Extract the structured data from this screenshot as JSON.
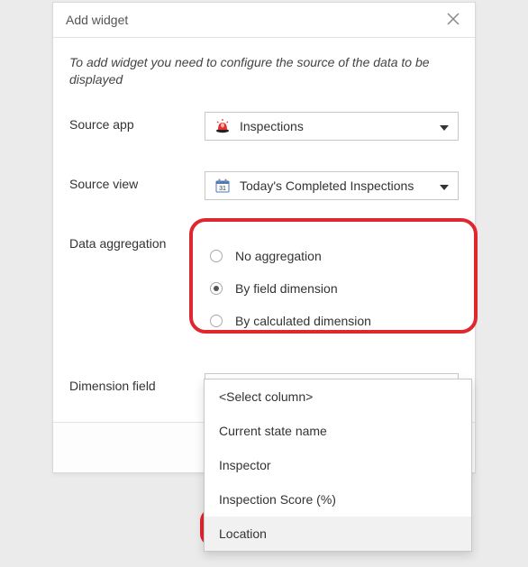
{
  "dialog": {
    "title": "Add widget",
    "intro": "To add widget you need to configure the source of the data to be displayed"
  },
  "fields": {
    "source_app": {
      "label": "Source app",
      "value": "Inspections"
    },
    "source_view": {
      "label": "Source view",
      "value": "Today's Completed Inspections"
    },
    "data_aggregation": {
      "label": "Data aggregation",
      "options": {
        "none": "No aggregation",
        "field": "By field dimension",
        "calc": "By calculated dimension"
      },
      "selected": "field"
    },
    "dimension_field": {
      "label": "Dimension field",
      "value": "<Select column>",
      "options": [
        "<Select column>",
        "Current state name",
        "Inspector",
        "Inspection Score (%)",
        "Location"
      ]
    }
  }
}
